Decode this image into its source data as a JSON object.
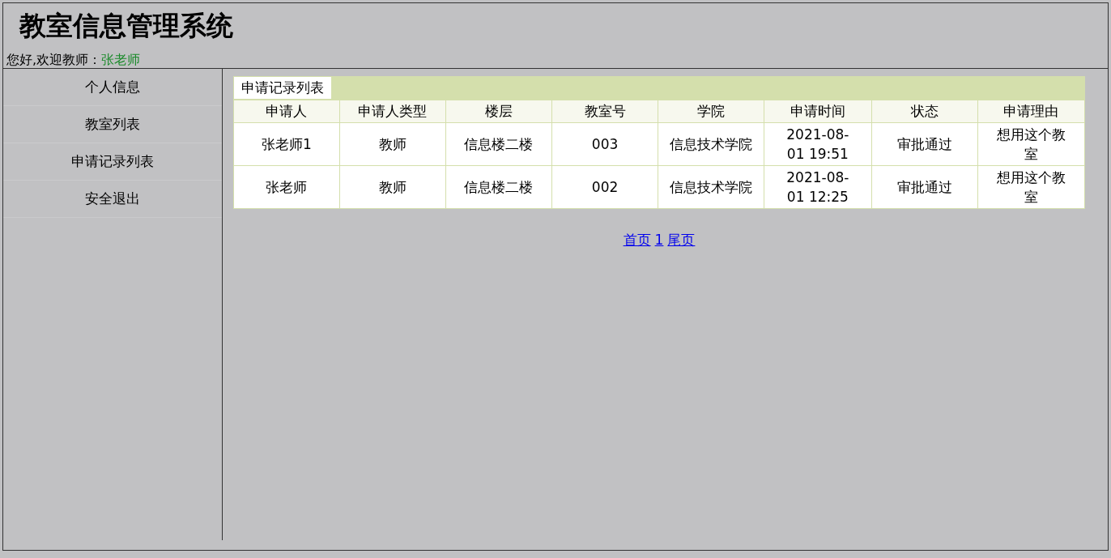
{
  "header": {
    "title": "教室信息管理系统",
    "greeting": "您好,欢迎教师：",
    "user_name": "张老师"
  },
  "sidebar": {
    "items": [
      {
        "label": "个人信息"
      },
      {
        "label": "教室列表"
      },
      {
        "label": "申请记录列表"
      },
      {
        "label": "安全退出"
      }
    ]
  },
  "panel": {
    "tab": "申请记录列表",
    "columns": [
      "申请人",
      "申请人类型",
      "楼层",
      "教室号",
      "学院",
      "申请时间",
      "状态",
      "申请理由"
    ],
    "rows": [
      [
        "张老师1",
        "教师",
        "信息楼二楼",
        "003",
        "信息技术学院",
        "2021-08-01 19:51",
        "审批通过",
        "想用这个教室"
      ],
      [
        "张老师",
        "教师",
        "信息楼二楼",
        "002",
        "信息技术学院",
        "2021-08-01 12:25",
        "审批通过",
        "想用这个教室"
      ]
    ]
  },
  "pagination": [
    {
      "label": "首页"
    },
    {
      "label": "1"
    },
    {
      "label": "尾页"
    }
  ]
}
